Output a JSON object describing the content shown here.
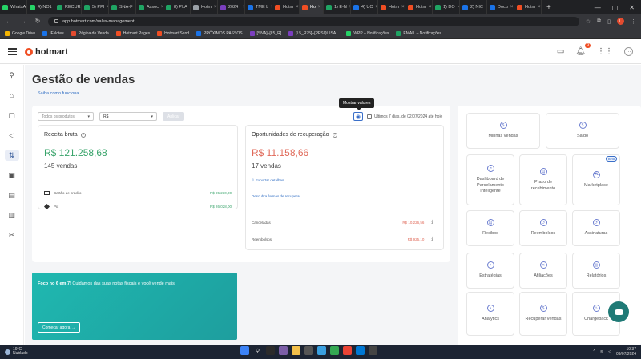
{
  "browser": {
    "tabs": [
      {
        "label": "WhatsA",
        "color": "#25d366"
      },
      {
        "label": "4) NO1",
        "color": "#25d366"
      },
      {
        "label": "RECUR",
        "color": "#1fa463"
      },
      {
        "label": "5) PPI",
        "color": "#1fa463"
      },
      {
        "label": "SNA-F",
        "color": "#1fa463"
      },
      {
        "label": "Assoc",
        "color": "#1fa463"
      },
      {
        "label": "8) PLA",
        "color": "#1fa463"
      },
      {
        "label": "Hotm",
        "color": "#9aa0a6"
      },
      {
        "label": "2024 I",
        "color": "#7b3fbf"
      },
      {
        "label": "TME L",
        "color": "#1a73e8"
      },
      {
        "label": "Hotm",
        "color": "#f04e23"
      },
      {
        "label": "Ho",
        "color": "#f04e23",
        "active": true
      },
      {
        "label": "1) E-N",
        "color": "#1fa463"
      },
      {
        "label": "4) UC",
        "color": "#1a73e8"
      },
      {
        "label": "Hotm",
        "color": "#f04e23"
      },
      {
        "label": "Hotm",
        "color": "#f04e23"
      },
      {
        "label": "1) DO",
        "color": "#1fa463"
      },
      {
        "label": "2) NIC",
        "color": "#1a73e8"
      },
      {
        "label": "Docu",
        "color": "#1a73e8"
      },
      {
        "label": "Hotm",
        "color": "#f04e23"
      }
    ],
    "url": "app.hotmart.com/sales-management",
    "profile_initial": "L",
    "bookmarks": [
      {
        "label": "Google Drive",
        "color": "#f4b400"
      },
      {
        "label": "IFNotes",
        "color": "#1a73e8"
      },
      {
        "label": "Página de Venda",
        "color": "#e34b2f"
      },
      {
        "label": "Hotmart Pages",
        "color": "#f04e23"
      },
      {
        "label": "Hotmart Send",
        "color": "#f04e23"
      },
      {
        "label": "PRÓXIMOS PASSOS",
        "color": "#1a73e8"
      },
      {
        "label": "[SNA]–[L5_R]",
        "color": "#7b3fbf"
      },
      {
        "label": "[L5_R75]–[PESQUISA...",
        "color": "#7b3fbf"
      },
      {
        "label": "WPP – Notificações",
        "color": "#25d366"
      },
      {
        "label": "EMAIL – Notificações",
        "color": "#1fa463"
      }
    ]
  },
  "header": {
    "logo_text": "hotmart",
    "notification_count": "9"
  },
  "page": {
    "title": "Gestão de vendas",
    "subtitle_link": "Saiba como funciona →",
    "tooltip": "Mostrar valores"
  },
  "filters": {
    "product_placeholder": "Todos os produtos",
    "currency": "R$",
    "apply_label": "Aplicar",
    "date_range": "Últimos 7 dias, de 02/07/2024 até hoje"
  },
  "gross_revenue": {
    "title": "Receita bruta",
    "value": "R$ 121.258,68",
    "count": "145 vendas",
    "payments": [
      {
        "method": "Cartão de crédito",
        "amount": "R$ 95.230,00"
      },
      {
        "method": "Pix",
        "amount": "R$ 26.028,00"
      }
    ]
  },
  "recovery": {
    "title": "Oportunidades de recuperação",
    "value": "R$ 11.158,66",
    "count": "17 vendas",
    "export_link": "Exportar detalhes",
    "other_link": "Descubra formas de recuperar →",
    "rows": [
      {
        "label": "Canceladas",
        "amount": "R$ 10.226,56"
      },
      {
        "label": "Reembolsos",
        "amount": "R$ 925,10"
      }
    ]
  },
  "banner": {
    "bold_text": "Foco no 6 em 7!",
    "text": " Cuidamos das suas notas fiscais e você vende mais.",
    "button": "Começar agora →"
  },
  "tiles": [
    {
      "label": "Minhas vendas",
      "icon": "$"
    },
    {
      "label": "Saldo",
      "icon": "$"
    },
    {
      "label": "Dashboard de Parcelamento Inteligente",
      "icon": "↗"
    },
    {
      "label": "Prazo de recebimento",
      "icon": "▤"
    },
    {
      "label": "Marketplace",
      "icon": "⛟",
      "badge": "Beta"
    },
    {
      "label": "Recibos",
      "icon": "▤"
    },
    {
      "label": "Reembolsos",
      "icon": "↺"
    },
    {
      "label": "Assinaturas",
      "icon": "⟳"
    },
    {
      "label": "Estratégias",
      "icon": "✦"
    },
    {
      "label": "Afiliações",
      "icon": "✕"
    },
    {
      "label": "Relatórios",
      "icon": "▥"
    },
    {
      "label": "Analytics",
      "icon": "◔"
    },
    {
      "label": "Recuperar vendas",
      "icon": "$"
    },
    {
      "label": "Chargeback",
      "icon": "⚠"
    }
  ],
  "taskbar": {
    "temp": "19°C",
    "weather": "Nublado",
    "time": "10:37",
    "date": "09/07/2024"
  },
  "colors": {
    "brand": "#f04e23",
    "green": "#39a46b",
    "red": "#e06a5a",
    "link": "#2f6dc3"
  }
}
